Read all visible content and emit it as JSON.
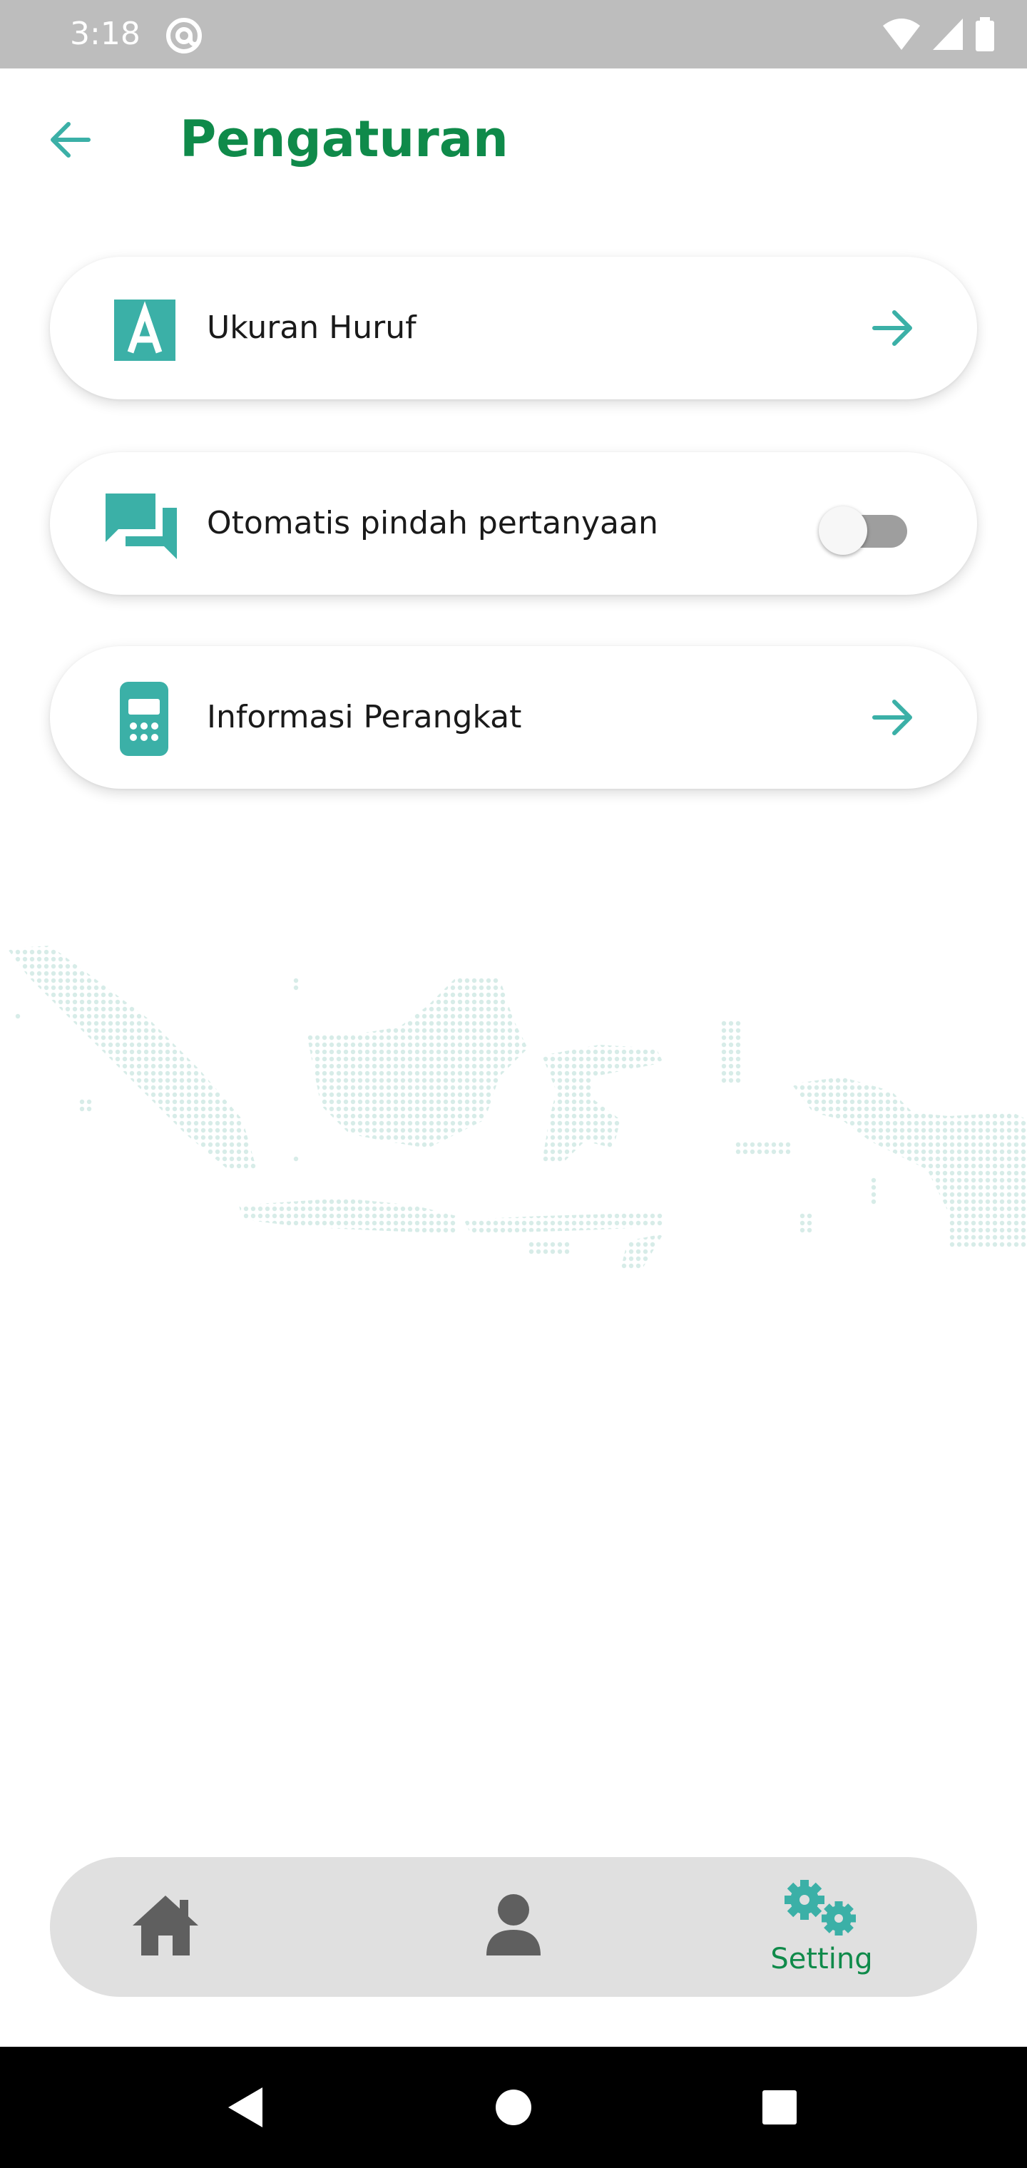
{
  "status_bar": {
    "time": "3:18"
  },
  "header": {
    "title": "Pengaturan"
  },
  "settings": [
    {
      "label": "Ukuran Huruf",
      "icon": "font-size-icon",
      "action": "arrow-right-icon"
    },
    {
      "label": "Otomatis pindah pertanyaan",
      "icon": "chat-bubbles-icon",
      "action": "toggle",
      "toggle_on": false
    },
    {
      "label": "Informasi Perangkat",
      "icon": "device-icon",
      "action": "arrow-right-icon"
    }
  ],
  "bottom_nav": {
    "items": [
      {
        "icon": "home-icon",
        "label": ""
      },
      {
        "icon": "profile-icon",
        "label": ""
      },
      {
        "icon": "settings-gears-icon",
        "label": "Setting",
        "active": true
      }
    ]
  },
  "colors": {
    "brand_green": "#0f8a4a",
    "accent_teal": "#3bb0a7",
    "map_dots": "#d7ece8",
    "nav_bg": "#e0e0e0",
    "nav_inactive": "#5f5f5f"
  }
}
